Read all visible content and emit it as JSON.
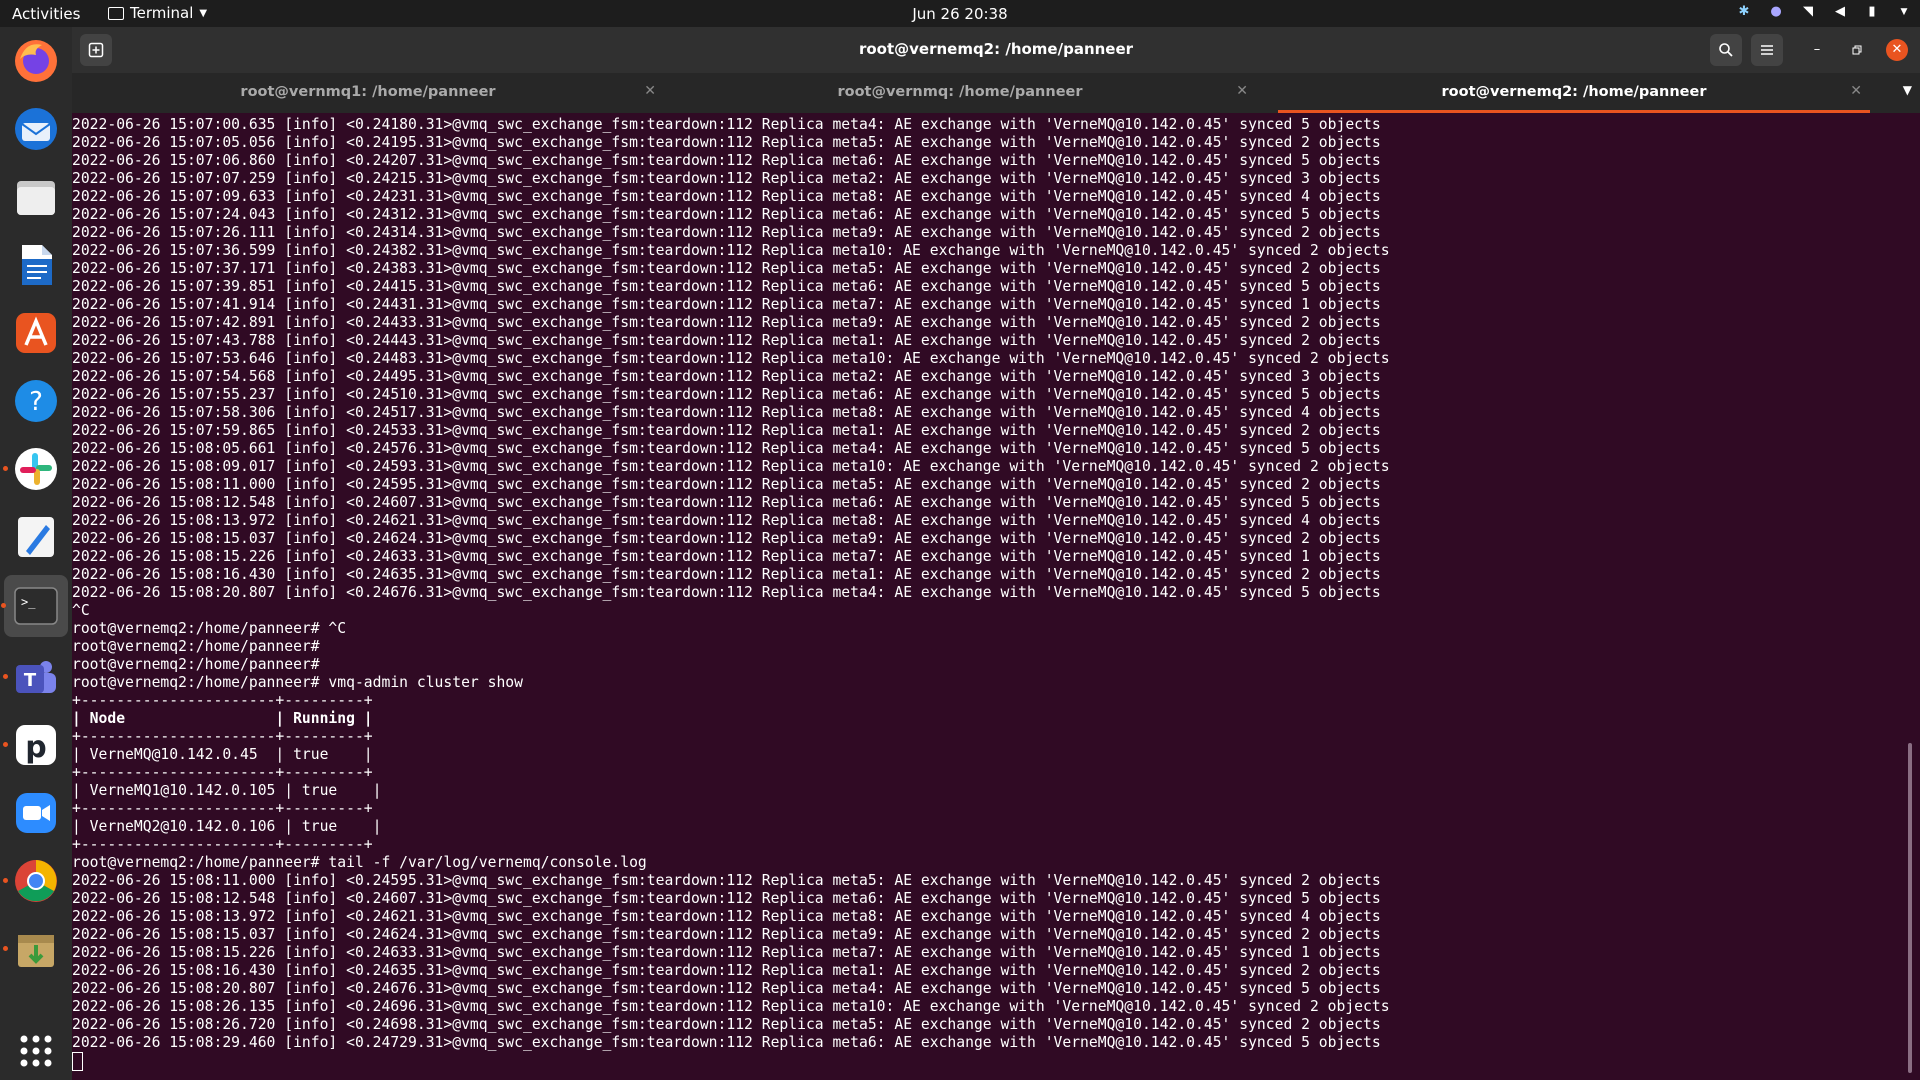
{
  "topbar": {
    "activities": "Activities",
    "app_name": "Terminal",
    "clock": "Jun 26  20:38"
  },
  "window": {
    "title": "root@vernemq2: /home/panneer"
  },
  "tabs": [
    {
      "label": "root@vernmq1: /home/panneer"
    },
    {
      "label": "root@vernmq: /home/panneer"
    },
    {
      "label": "root@vernemq2: /home/panneer"
    }
  ],
  "dock": {
    "apps": [
      "firefox-icon",
      "thunderbird-icon",
      "files-icon",
      "writer-icon",
      "app-center-icon",
      "help-icon",
      "slack-icon",
      "text-editor-icon",
      "terminal-icon",
      "teams-icon",
      "pcloud-icon",
      "zoom-icon",
      "chrome-icon",
      "archive-manager-icon",
      "show-apps-icon"
    ]
  },
  "terminal": {
    "lines": [
      "2022-06-26 15:07:00.635 [info] <0.24180.31>@vmq_swc_exchange_fsm:teardown:112 Replica meta4: AE exchange with 'VerneMQ@10.142.0.45' synced 5 objects",
      "2022-06-26 15:07:05.056 [info] <0.24195.31>@vmq_swc_exchange_fsm:teardown:112 Replica meta5: AE exchange with 'VerneMQ@10.142.0.45' synced 2 objects",
      "2022-06-26 15:07:06.860 [info] <0.24207.31>@vmq_swc_exchange_fsm:teardown:112 Replica meta6: AE exchange with 'VerneMQ@10.142.0.45' synced 5 objects",
      "2022-06-26 15:07:07.259 [info] <0.24215.31>@vmq_swc_exchange_fsm:teardown:112 Replica meta2: AE exchange with 'VerneMQ@10.142.0.45' synced 3 objects",
      "2022-06-26 15:07:09.633 [info] <0.24231.31>@vmq_swc_exchange_fsm:teardown:112 Replica meta8: AE exchange with 'VerneMQ@10.142.0.45' synced 4 objects",
      "2022-06-26 15:07:24.043 [info] <0.24312.31>@vmq_swc_exchange_fsm:teardown:112 Replica meta6: AE exchange with 'VerneMQ@10.142.0.45' synced 5 objects",
      "2022-06-26 15:07:26.111 [info] <0.24314.31>@vmq_swc_exchange_fsm:teardown:112 Replica meta9: AE exchange with 'VerneMQ@10.142.0.45' synced 2 objects",
      "2022-06-26 15:07:36.599 [info] <0.24382.31>@vmq_swc_exchange_fsm:teardown:112 Replica meta10: AE exchange with 'VerneMQ@10.142.0.45' synced 2 objects",
      "2022-06-26 15:07:37.171 [info] <0.24383.31>@vmq_swc_exchange_fsm:teardown:112 Replica meta5: AE exchange with 'VerneMQ@10.142.0.45' synced 2 objects",
      "2022-06-26 15:07:39.851 [info] <0.24415.31>@vmq_swc_exchange_fsm:teardown:112 Replica meta6: AE exchange with 'VerneMQ@10.142.0.45' synced 5 objects",
      "2022-06-26 15:07:41.914 [info] <0.24431.31>@vmq_swc_exchange_fsm:teardown:112 Replica meta7: AE exchange with 'VerneMQ@10.142.0.45' synced 1 objects",
      "2022-06-26 15:07:42.891 [info] <0.24433.31>@vmq_swc_exchange_fsm:teardown:112 Replica meta9: AE exchange with 'VerneMQ@10.142.0.45' synced 2 objects",
      "2022-06-26 15:07:43.788 [info] <0.24443.31>@vmq_swc_exchange_fsm:teardown:112 Replica meta1: AE exchange with 'VerneMQ@10.142.0.45' synced 2 objects",
      "2022-06-26 15:07:53.646 [info] <0.24483.31>@vmq_swc_exchange_fsm:teardown:112 Replica meta10: AE exchange with 'VerneMQ@10.142.0.45' synced 2 objects",
      "2022-06-26 15:07:54.568 [info] <0.24495.31>@vmq_swc_exchange_fsm:teardown:112 Replica meta2: AE exchange with 'VerneMQ@10.142.0.45' synced 3 objects",
      "2022-06-26 15:07:55.237 [info] <0.24510.31>@vmq_swc_exchange_fsm:teardown:112 Replica meta6: AE exchange with 'VerneMQ@10.142.0.45' synced 5 objects",
      "2022-06-26 15:07:58.306 [info] <0.24517.31>@vmq_swc_exchange_fsm:teardown:112 Replica meta8: AE exchange with 'VerneMQ@10.142.0.45' synced 4 objects",
      "2022-06-26 15:07:59.865 [info] <0.24533.31>@vmq_swc_exchange_fsm:teardown:112 Replica meta1: AE exchange with 'VerneMQ@10.142.0.45' synced 2 objects",
      "2022-06-26 15:08:05.661 [info] <0.24576.31>@vmq_swc_exchange_fsm:teardown:112 Replica meta4: AE exchange with 'VerneMQ@10.142.0.45' synced 5 objects",
      "2022-06-26 15:08:09.017 [info] <0.24593.31>@vmq_swc_exchange_fsm:teardown:112 Replica meta10: AE exchange with 'VerneMQ@10.142.0.45' synced 2 objects",
      "2022-06-26 15:08:11.000 [info] <0.24595.31>@vmq_swc_exchange_fsm:teardown:112 Replica meta5: AE exchange with 'VerneMQ@10.142.0.45' synced 2 objects",
      "2022-06-26 15:08:12.548 [info] <0.24607.31>@vmq_swc_exchange_fsm:teardown:112 Replica meta6: AE exchange with 'VerneMQ@10.142.0.45' synced 5 objects",
      "2022-06-26 15:08:13.972 [info] <0.24621.31>@vmq_swc_exchange_fsm:teardown:112 Replica meta8: AE exchange with 'VerneMQ@10.142.0.45' synced 4 objects",
      "2022-06-26 15:08:15.037 [info] <0.24624.31>@vmq_swc_exchange_fsm:teardown:112 Replica meta9: AE exchange with 'VerneMQ@10.142.0.45' synced 2 objects",
      "2022-06-26 15:08:15.226 [info] <0.24633.31>@vmq_swc_exchange_fsm:teardown:112 Replica meta7: AE exchange with 'VerneMQ@10.142.0.45' synced 1 objects",
      "2022-06-26 15:08:16.430 [info] <0.24635.31>@vmq_swc_exchange_fsm:teardown:112 Replica meta1: AE exchange with 'VerneMQ@10.142.0.45' synced 2 objects",
      "2022-06-26 15:08:20.807 [info] <0.24676.31>@vmq_swc_exchange_fsm:teardown:112 Replica meta4: AE exchange with 'VerneMQ@10.142.0.45' synced 5 objects",
      "^C",
      "root@vernemq2:/home/panneer# ^C",
      "root@vernemq2:/home/panneer#",
      "root@vernemq2:/home/panneer#",
      "root@vernemq2:/home/panneer# vmq-admin cluster show",
      "+----------------------+---------+",
      "| Node                 | Running |",
      "+----------------------+---------+",
      "| VerneMQ@10.142.0.45  | true    |",
      "+----------------------+---------+",
      "| VerneMQ1@10.142.0.105 | true    |",
      "+----------------------+---------+",
      "| VerneMQ2@10.142.0.106 | true    |",
      "+----------------------+---------+",
      "root@vernemq2:/home/panneer# tail -f /var/log/vernemq/console.log",
      "2022-06-26 15:08:11.000 [info] <0.24595.31>@vmq_swc_exchange_fsm:teardown:112 Replica meta5: AE exchange with 'VerneMQ@10.142.0.45' synced 2 objects",
      "2022-06-26 15:08:12.548 [info] <0.24607.31>@vmq_swc_exchange_fsm:teardown:112 Replica meta6: AE exchange with 'VerneMQ@10.142.0.45' synced 5 objects",
      "2022-06-26 15:08:13.972 [info] <0.24621.31>@vmq_swc_exchange_fsm:teardown:112 Replica meta8: AE exchange with 'VerneMQ@10.142.0.45' synced 4 objects",
      "2022-06-26 15:08:15.037 [info] <0.24624.31>@vmq_swc_exchange_fsm:teardown:112 Replica meta9: AE exchange with 'VerneMQ@10.142.0.45' synced 2 objects",
      "2022-06-26 15:08:15.226 [info] <0.24633.31>@vmq_swc_exchange_fsm:teardown:112 Replica meta7: AE exchange with 'VerneMQ@10.142.0.45' synced 1 objects",
      "2022-06-26 15:08:16.430 [info] <0.24635.31>@vmq_swc_exchange_fsm:teardown:112 Replica meta1: AE exchange with 'VerneMQ@10.142.0.45' synced 2 objects",
      "2022-06-26 15:08:20.807 [info] <0.24676.31>@vmq_swc_exchange_fsm:teardown:112 Replica meta4: AE exchange with 'VerneMQ@10.142.0.45' synced 5 objects",
      "2022-06-26 15:08:26.135 [info] <0.24696.31>@vmq_swc_exchange_fsm:teardown:112 Replica meta10: AE exchange with 'VerneMQ@10.142.0.45' synced 2 objects",
      "2022-06-26 15:08:26.720 [info] <0.24698.31>@vmq_swc_exchange_fsm:teardown:112 Replica meta5: AE exchange with 'VerneMQ@10.142.0.45' synced 2 objects",
      "2022-06-26 15:08:29.460 [info] <0.24729.31>@vmq_swc_exchange_fsm:teardown:112 Replica meta6: AE exchange with 'VerneMQ@10.142.0.45' synced 5 objects"
    ]
  }
}
